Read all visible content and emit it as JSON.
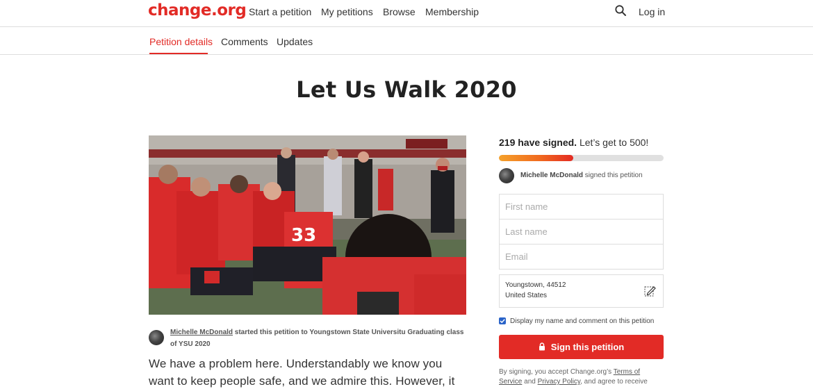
{
  "header": {
    "logo": "change.org",
    "nav": [
      "Start a petition",
      "My petitions",
      "Browse",
      "Membership"
    ],
    "login": "Log in"
  },
  "tabs": [
    "Petition details",
    "Comments",
    "Updates"
  ],
  "petition": {
    "title": "Let Us Walk 2020",
    "starter_name": "Michelle McDonald",
    "starter_text": " started this petition to Youngstown State Universitu Graduating class of YSU 2020",
    "body": "We have a problem here. Understandably we know you want to keep people safe, and we admire this. However, it has gotten to"
  },
  "sidebar": {
    "signed_count": "219 have signed.",
    "goal_text": " Let’s get to 500!",
    "progress_fraction": 0.45,
    "recent_signer": "Michelle McDonald",
    "recent_text": " signed this petition",
    "first_name_placeholder": "First name",
    "last_name_placeholder": "Last name",
    "email_placeholder": "Email",
    "location_line1": "Youngstown, 44512",
    "location_line2": "United States",
    "display_label": "Display my name and comment on this petition",
    "sign_button": "Sign this petition",
    "legal_prefix": "By signing, you accept Change.org’s ",
    "legal_terms": "Terms of Service",
    "legal_and": " and ",
    "legal_privacy": "Privacy Policy",
    "legal_suffix": ", and agree to receive"
  },
  "colors": {
    "brand_red": "#e22b26",
    "checkbox_blue": "#2a63c8"
  },
  "icons": [
    "search-icon",
    "edit-location-icon",
    "lock-icon",
    "check-icon"
  ]
}
